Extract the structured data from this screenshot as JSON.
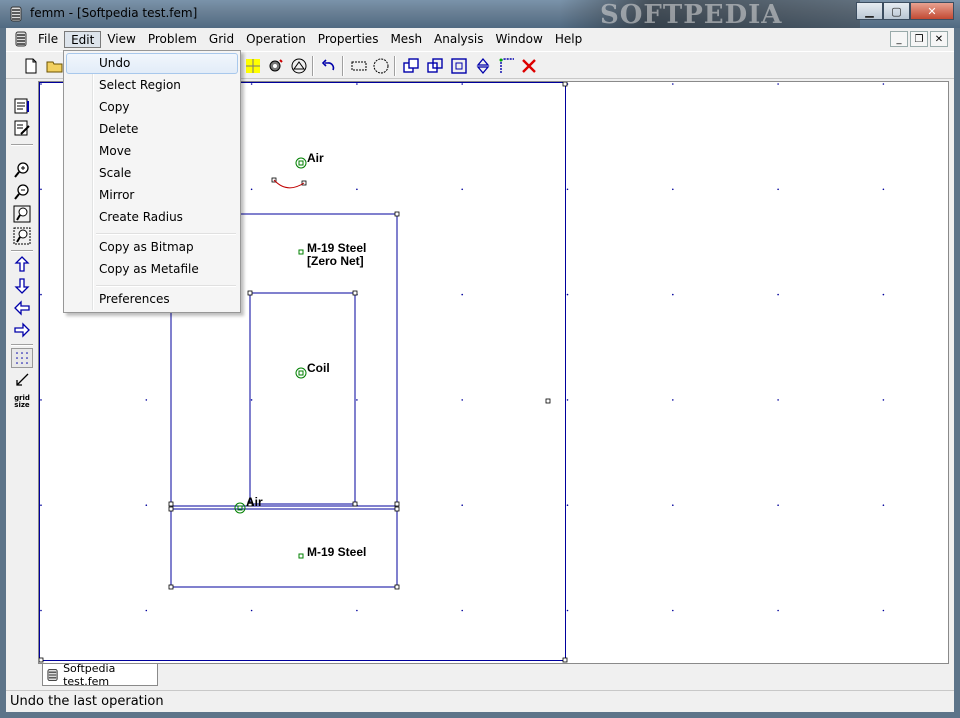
{
  "window": {
    "title": "femm - [Softpedia test.fem]",
    "watermark": "SOFTPEDIA"
  },
  "titlebar_buttons": {
    "minimize": "▁",
    "maximize": "▢",
    "close": "✕"
  },
  "menubar": {
    "items": [
      "File",
      "Edit",
      "View",
      "Problem",
      "Grid",
      "Operation",
      "Properties",
      "Mesh",
      "Analysis",
      "Window",
      "Help"
    ],
    "active": "Edit",
    "mdi_buttons": {
      "minimize": "_",
      "restore": "❐",
      "close": "✕"
    }
  },
  "edit_menu": {
    "items": [
      {
        "label": "Undo",
        "highlighted": true
      },
      {
        "label": "Select Region"
      },
      {
        "label": "Copy"
      },
      {
        "label": "Delete"
      },
      {
        "label": "Move"
      },
      {
        "label": "Scale"
      },
      {
        "label": "Mirror"
      },
      {
        "label": "Create Radius"
      },
      {
        "label": "Copy as Bitmap"
      },
      {
        "label": "Copy as Metafile"
      },
      {
        "label": "Preferences"
      }
    ]
  },
  "left_toolbar": {
    "grid_size_label": "grid size"
  },
  "canvas": {
    "block_labels": {
      "air_top": "Air",
      "steel_top_1": "M-19 Steel",
      "steel_top_2": "[Zero Net]",
      "coil": "Coil",
      "air_gap": "Air",
      "steel_bottom": "M-19 Steel"
    }
  },
  "doc_tab": {
    "label": "Softpedia test.fem"
  },
  "status": {
    "text": "Undo the last operation"
  },
  "colors": {
    "geometry": "#00009c",
    "arc": "#c00000",
    "label_marker": "#008000"
  }
}
